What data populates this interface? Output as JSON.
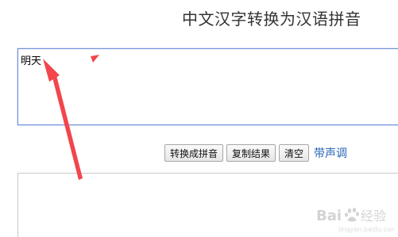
{
  "page": {
    "title": "中文汉字转换为汉语拼音"
  },
  "input": {
    "value": "明天"
  },
  "toolbar": {
    "convert_label": "转换成拼音",
    "copy_label": "复制结果",
    "clear_label": "清空",
    "tone_link_label": "带声调"
  },
  "output": {
    "value": ""
  },
  "watermark": {
    "text": "Bai 经验",
    "sub": "jingyan.baidu.com"
  },
  "colors": {
    "annotation_arrow": "#f2464c",
    "link": "#2563b8",
    "input_border": "#6a8dd8"
  }
}
